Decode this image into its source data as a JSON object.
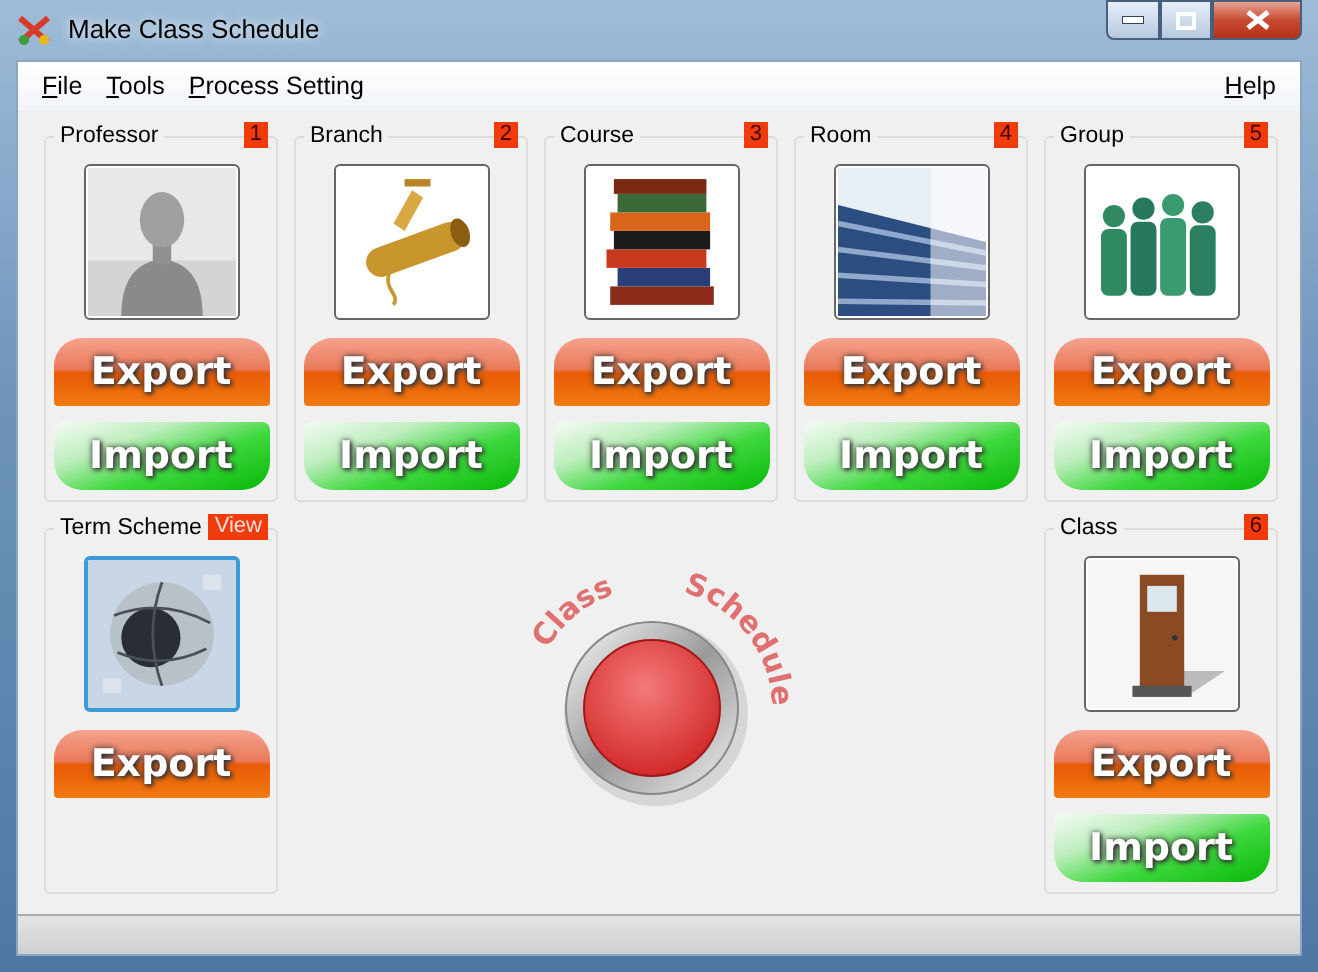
{
  "window": {
    "title": "Make Class Schedule"
  },
  "menu_left": [
    {
      "label": "File",
      "underline_first": true
    },
    {
      "label": "Tools",
      "underline_first": true
    },
    {
      "label": "Process Setting",
      "underline_first": true
    }
  ],
  "menu_right": [
    {
      "label": "Help",
      "underline_first": true
    }
  ],
  "top_groups": [
    {
      "title": "Professor",
      "badge": "1",
      "picture": {
        "kind": "picture",
        "selected": false
      },
      "buttons": [
        {
          "label": "Export",
          "kind": "export"
        },
        {
          "label": "Import",
          "kind": "import"
        }
      ]
    },
    {
      "title": "Branch",
      "badge": "2",
      "picture": {
        "kind": "picture",
        "selected": false
      },
      "buttons": [
        {
          "label": "Export",
          "kind": "export"
        },
        {
          "label": "Import",
          "kind": "import"
        }
      ]
    },
    {
      "title": "Course",
      "badge": "3",
      "picture": {
        "kind": "picture",
        "selected": false
      },
      "buttons": [
        {
          "label": "Export",
          "kind": "export"
        },
        {
          "label": "Import",
          "kind": "import"
        }
      ]
    },
    {
      "title": "Room",
      "badge": "4",
      "picture": {
        "kind": "picture",
        "selected": false
      },
      "buttons": [
        {
          "label": "Export",
          "kind": "export"
        },
        {
          "label": "Import",
          "kind": "import"
        }
      ]
    },
    {
      "title": "Group",
      "badge": "5",
      "picture": {
        "kind": "picture",
        "selected": false
      },
      "buttons": [
        {
          "label": "Export",
          "kind": "export"
        },
        {
          "label": "Import",
          "kind": "import"
        }
      ]
    }
  ],
  "bottom_groups": [
    {
      "title": "Term Scheme",
      "badge": "View",
      "picture": {
        "kind": "picture",
        "selected": true
      },
      "buttons": [
        {
          "label": "Export",
          "kind": "export"
        }
      ]
    },
    {
      "title": "Class",
      "badge": "6",
      "picture": {
        "kind": "picture",
        "selected": false
      },
      "buttons": [
        {
          "label": "Export",
          "kind": "export"
        },
        {
          "label": "Import",
          "kind": "import"
        }
      ]
    }
  ],
  "start_button": {
    "labels": [
      "Class",
      "Schedule"
    ]
  }
}
